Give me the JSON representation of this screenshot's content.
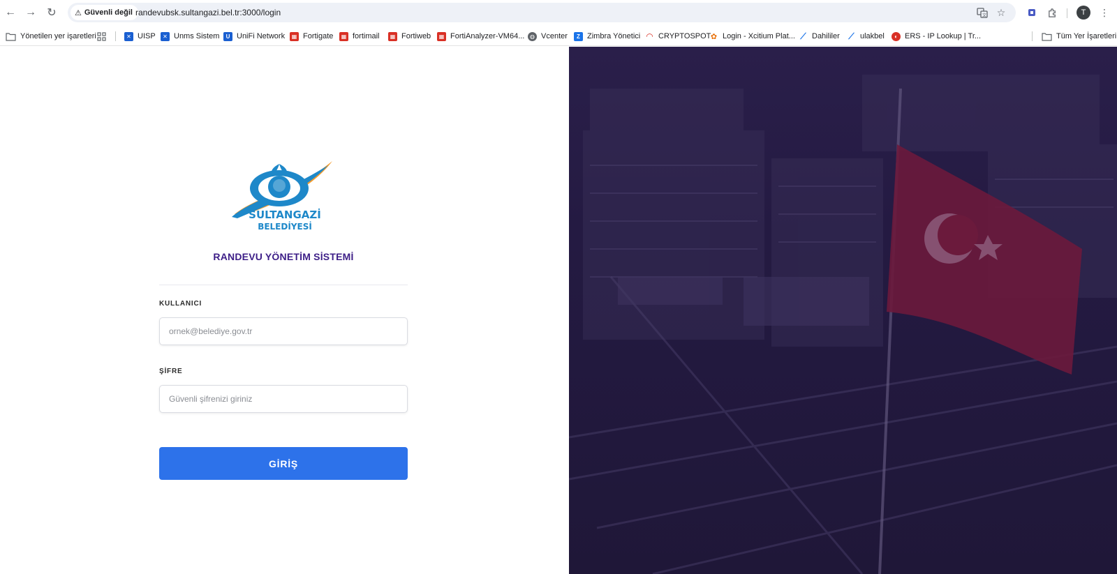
{
  "browser": {
    "security_label": "Güvenli değil",
    "url": "randevubsk.sultangazi.bel.tr:3000/login",
    "profile_initial": "T"
  },
  "bookmarks": {
    "items": [
      {
        "label": "Yönetilen yer işaretleri",
        "icon": "managed-bookmarks-icon",
        "color": "#5f6368"
      },
      {
        "label": "UISP",
        "icon": "uisp-icon",
        "color": "#1a5fd1"
      },
      {
        "label": "Unms Sistem",
        "icon": "unms-icon",
        "color": "#1a5fd1"
      },
      {
        "label": "UniFi Network",
        "icon": "unifi-icon",
        "color": "#1a5fd1"
      },
      {
        "label": "Fortigate",
        "icon": "fortigate-icon",
        "color": "#d93025"
      },
      {
        "label": "fortimail",
        "icon": "fortimail-icon",
        "color": "#d93025"
      },
      {
        "label": "Fortiweb",
        "icon": "fortiweb-icon",
        "color": "#d93025"
      },
      {
        "label": "FortiAnalyzer-VM64...",
        "icon": "fortianalyzer-icon",
        "color": "#d93025"
      },
      {
        "label": "Vcenter",
        "icon": "globe-icon",
        "color": "#5f6368"
      },
      {
        "label": "Zimbra Yönetici",
        "icon": "zimbra-icon",
        "color": "#1a73e8"
      },
      {
        "label": "CRYPTOSPOT",
        "icon": "cryptospot-icon",
        "color": "#d93025"
      },
      {
        "label": "Login - Xcitium Plat...",
        "icon": "xcitium-icon",
        "color": "#e8710a"
      },
      {
        "label": "Dahililer",
        "icon": "dahililer-icon",
        "color": "#1a73e8"
      },
      {
        "label": "ulakbel",
        "icon": "ulakbel-icon",
        "color": "#1a73e8"
      },
      {
        "label": "ERS - IP Lookup | Tr...",
        "icon": "ers-icon",
        "color": "#d93025"
      }
    ],
    "all_bookmarks_label": "Tüm Yer İşaretleri"
  },
  "login": {
    "logo_line1": "SULTANGAZİ",
    "logo_line2": "BELEDİYESİ",
    "title": "RANDEVU YÖNETİM SİSTEMİ",
    "user_label": "KULLANICI",
    "user_placeholder": "ornek@belediye.gov.tr",
    "password_label": "ŞİFRE",
    "password_placeholder": "Güvenli şifrenizi giriniz",
    "submit_label": "GİRİŞ"
  },
  "colors": {
    "title": "#3d1e87",
    "button": "#2d72ea",
    "hero_overlay": "#241a42",
    "logo_blue": "#1e88c9",
    "logo_orange": "#f39a2b"
  }
}
